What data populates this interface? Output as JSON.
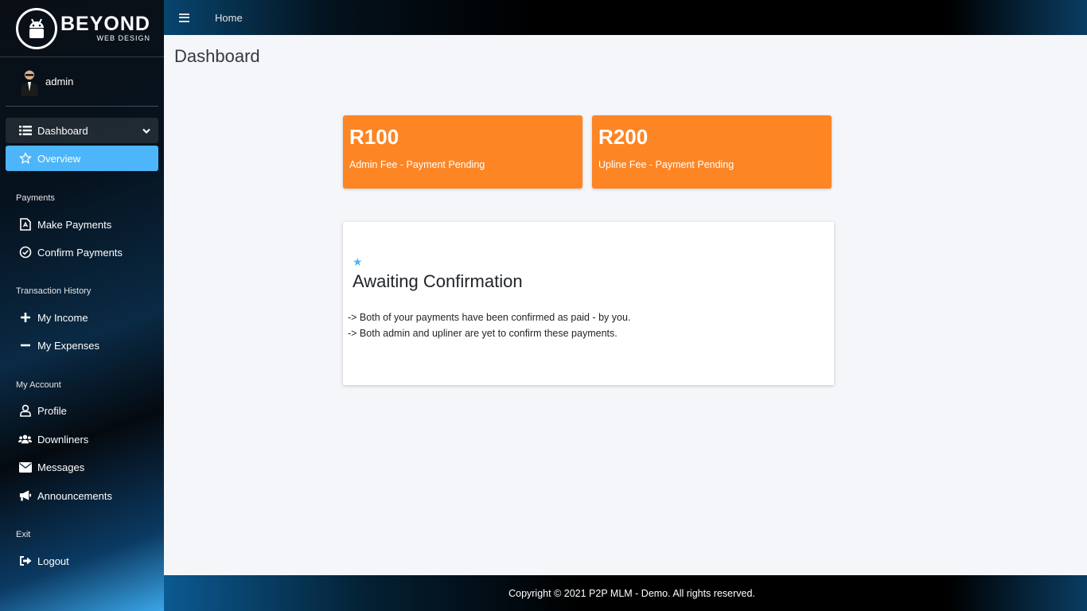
{
  "brand": {
    "name": "BEYOND",
    "subtitle": "WEB DESIGN"
  },
  "user": {
    "name": "admin"
  },
  "topbar": {
    "home_label": "Home"
  },
  "sidebar": {
    "dashboard_label": "Dashboard",
    "overview_label": "Overview",
    "sections": {
      "payments": "Payments",
      "transaction_history": "Transaction History",
      "my_account": "My Account",
      "exit": "Exit"
    },
    "items": {
      "make_payments": "Make Payments",
      "confirm_payments": "Confirm Payments",
      "my_income": "My Income",
      "my_expenses": "My Expenses",
      "profile": "Profile",
      "downliners": "Downliners",
      "messages": "Messages",
      "announcements": "Announcements",
      "logout": "Logout"
    }
  },
  "page": {
    "title": "Dashboard"
  },
  "fees": {
    "admin": {
      "amount": "R100",
      "label": "Admin Fee - Payment Pending"
    },
    "upline": {
      "amount": "R200",
      "label": "Upline Fee - Payment Pending"
    }
  },
  "status_card": {
    "title": "Awaiting Confirmation",
    "line1": "-> Both of your payments have been confirmed as paid - by you.",
    "line2": "-> Both admin and upliner are yet to confirm these payments."
  },
  "footer": {
    "text": "Copyright © 2021 P2P MLM - Demo. All rights reserved."
  },
  "colors": {
    "accent": "#4db5f9",
    "fee_box": "#fd8524",
    "background": "#f4f6f9"
  }
}
